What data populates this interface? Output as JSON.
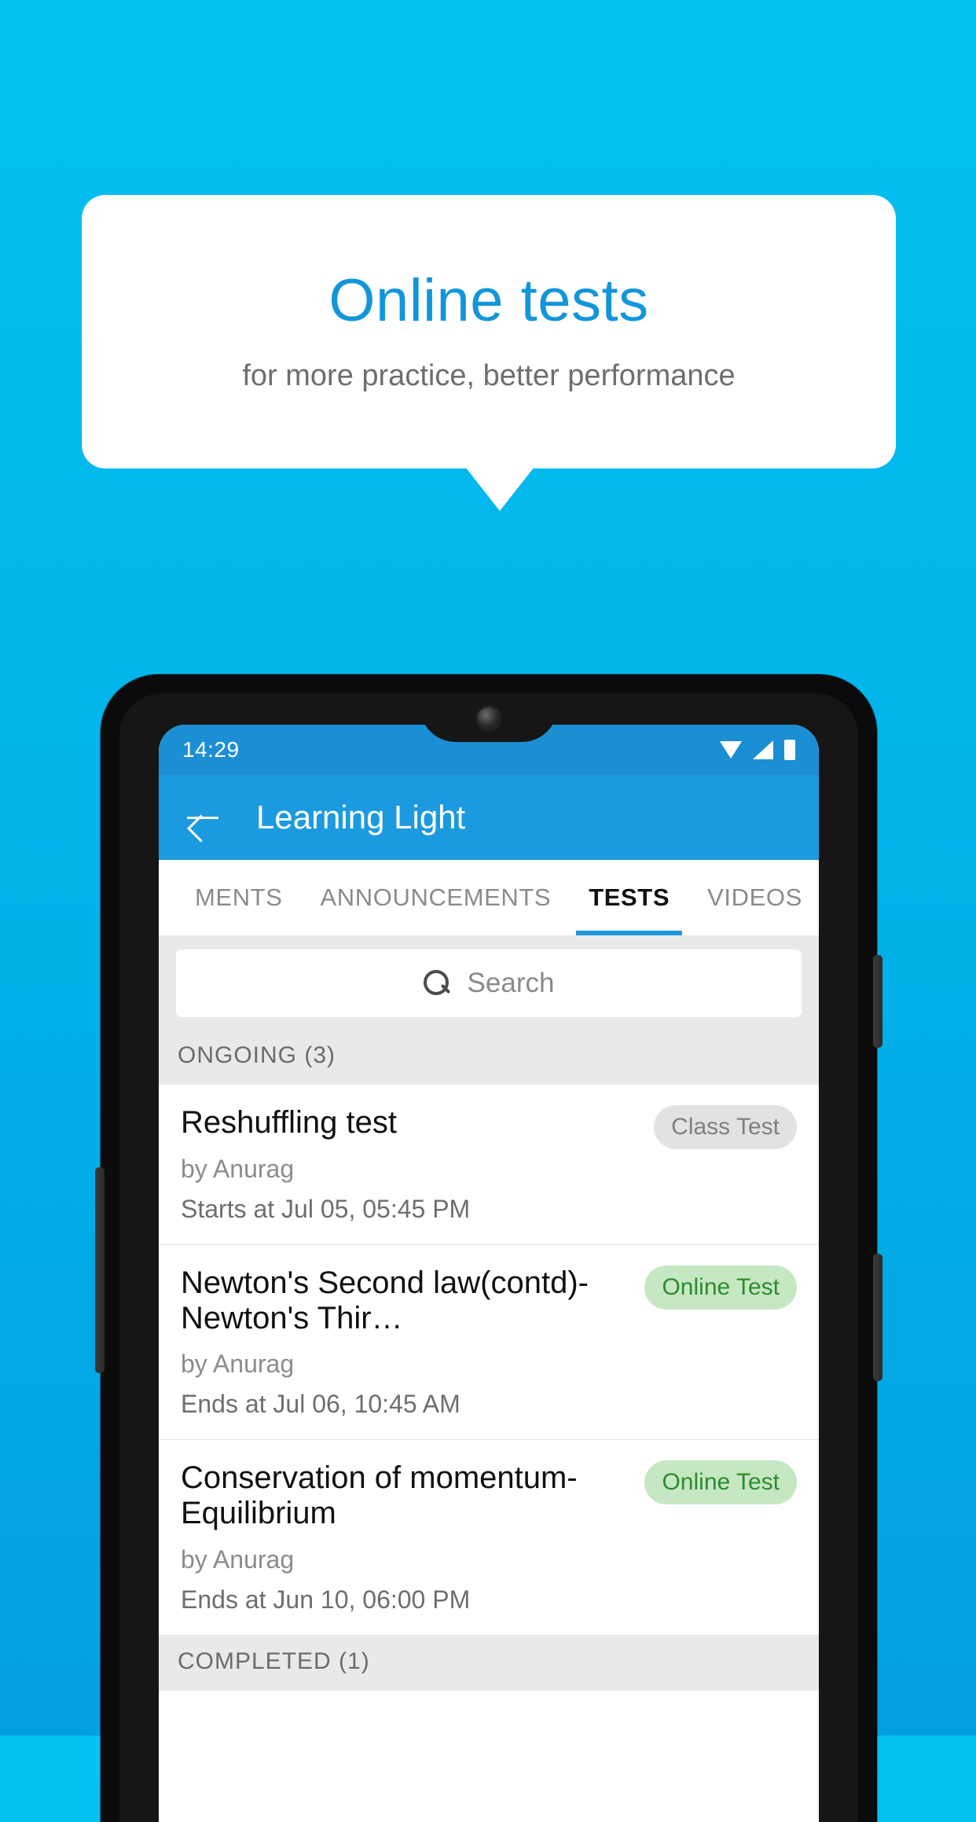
{
  "promo": {
    "title": "Online tests",
    "subtitle": "for more practice, better performance",
    "title_color": "#1296DB",
    "subtitle_color": "#6E6E6E"
  },
  "background": {
    "top_color": "#03C0F2",
    "bottom_color": "#029FE0"
  },
  "phone": {
    "status_bar": {
      "time": "14:29",
      "icons": [
        "wifi-icon",
        "signal-icon",
        "battery-icon"
      ],
      "background": "#1C8FD4"
    },
    "appbar": {
      "back_icon": "back-arrow-icon",
      "title": "Learning Light",
      "background": "#1C9AE0"
    },
    "tabs": [
      {
        "label": "MENTS",
        "active": false
      },
      {
        "label": "ANNOUNCEMENTS",
        "active": false
      },
      {
        "label": "TESTS",
        "active": true
      },
      {
        "label": "VIDEOS",
        "active": false
      }
    ],
    "tab_indicator_color": "#1F97DB",
    "search": {
      "icon": "search-icon",
      "placeholder": "Search",
      "value": ""
    },
    "sections": [
      {
        "header": "ONGOING (3)",
        "items": [
          {
            "title": "Reshuffling test",
            "author": "by Anurag",
            "schedule": "Starts at  Jul 05, 05:45 PM",
            "badge": "Class Test",
            "badge_style": "grey"
          },
          {
            "title": "Newton's Second law(contd)-Newton's Thir…",
            "author": "by Anurag",
            "schedule": "Ends at  Jul 06, 10:45 AM",
            "badge": "Online Test",
            "badge_style": "green"
          },
          {
            "title": "Conservation of momentum-Equilibrium",
            "author": "by Anurag",
            "schedule": "Ends at  Jun 10, 06:00 PM",
            "badge": "Online Test",
            "badge_style": "green"
          }
        ]
      },
      {
        "header": "COMPLETED (1)",
        "items": []
      }
    ]
  }
}
